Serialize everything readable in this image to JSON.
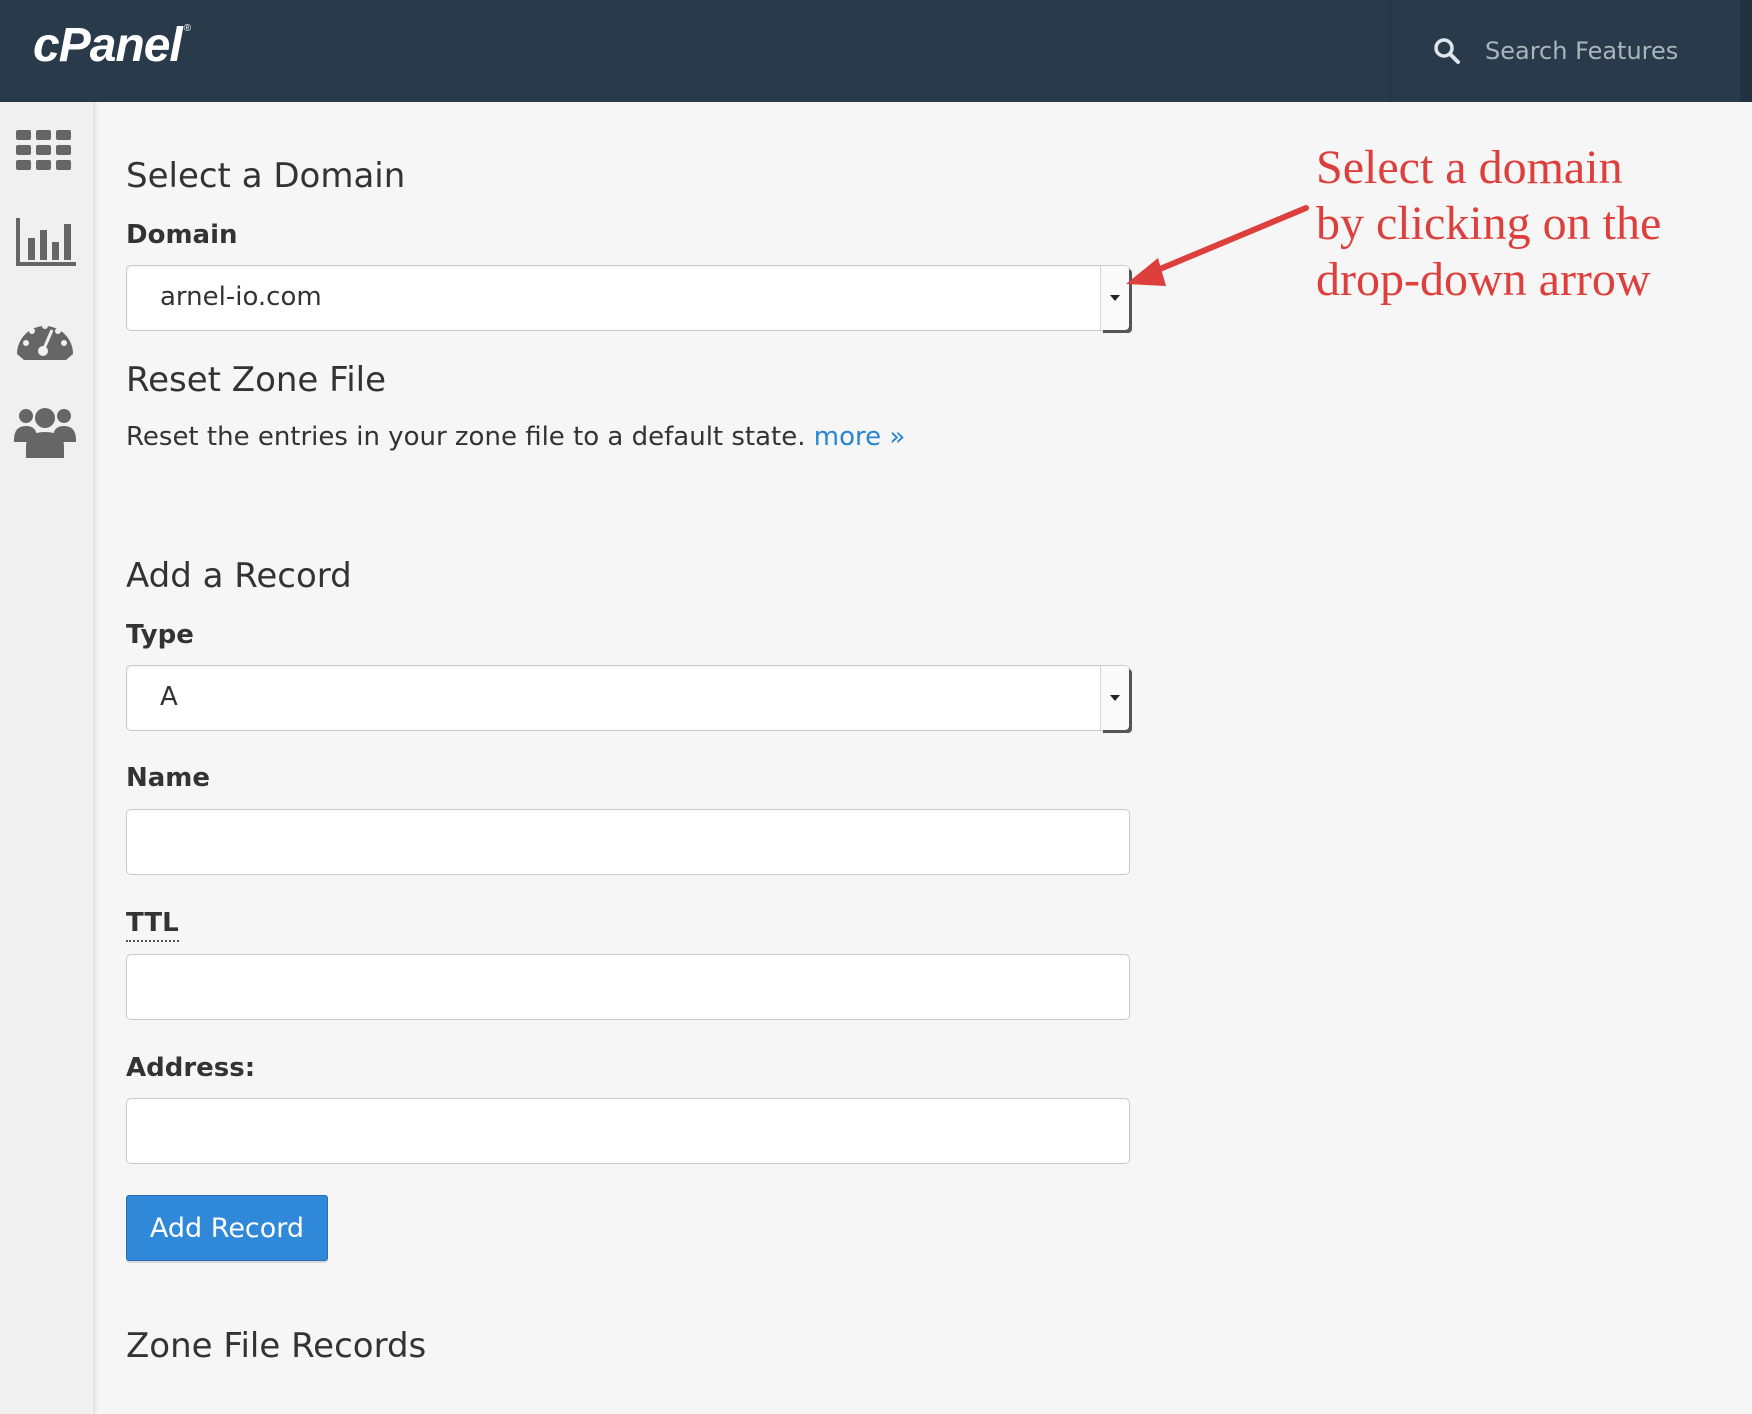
{
  "header": {
    "logo": "cPanel",
    "logo_mark": "®",
    "search_placeholder": "Search Features",
    "search_icon": "search-icon"
  },
  "sidebar": {
    "items": [
      {
        "icon": "grid-icon"
      },
      {
        "icon": "bar-chart-icon"
      },
      {
        "icon": "dashboard-gauge-icon"
      },
      {
        "icon": "users-icon"
      }
    ]
  },
  "select_domain": {
    "heading": "Select a Domain",
    "label": "Domain",
    "selected_value": "arnel-io.com"
  },
  "reset_zone": {
    "heading": "Reset Zone File",
    "description": "Reset the entries in your zone file to a default state.",
    "link": "more »"
  },
  "add_record": {
    "heading": "Add a Record",
    "type_label": "Type",
    "type_value": "A",
    "name_label": "Name",
    "name_value": "",
    "ttl_label": "TTL",
    "ttl_value": "",
    "address_label": "Address:",
    "address_value": "",
    "submit_label": "Add Record"
  },
  "zone_records": {
    "heading": "Zone File Records"
  },
  "annotation": {
    "lines": [
      "Select a domain",
      "by clicking on the",
      "drop-down arrow"
    ],
    "color": "#dd3f3c"
  },
  "colors": {
    "topbar": "#293a4a",
    "primary_button": "#2f89d8",
    "link": "#2a85d2"
  }
}
